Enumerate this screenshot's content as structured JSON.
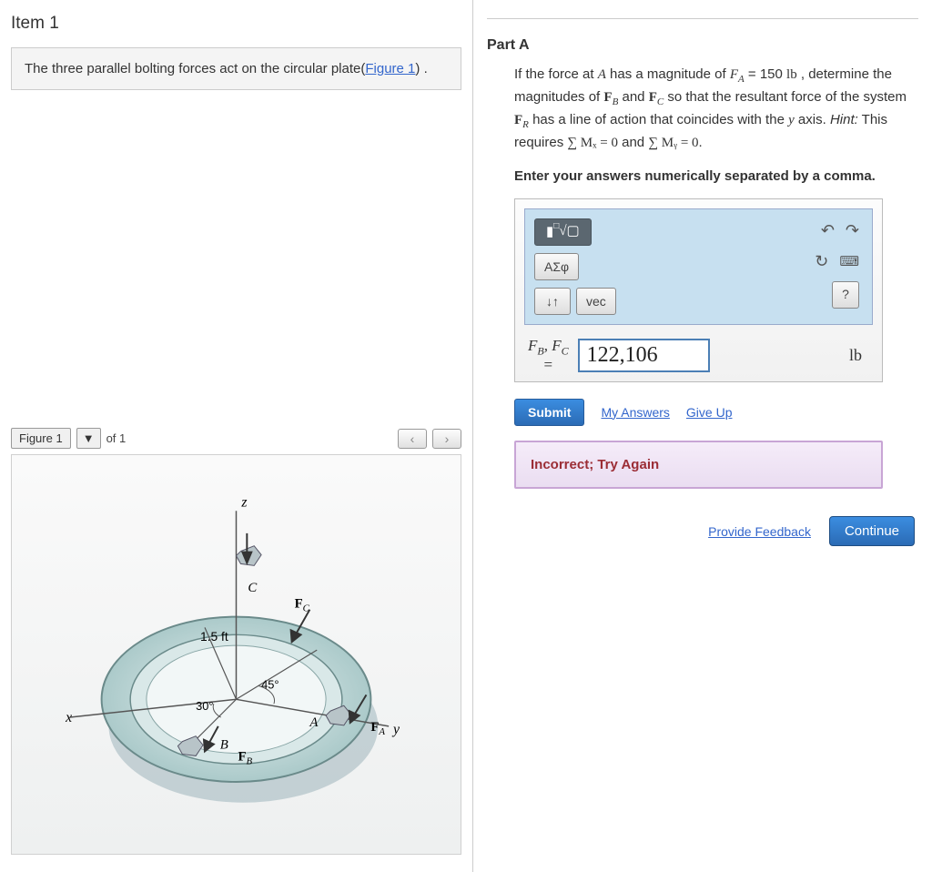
{
  "item": {
    "title": "Item 1",
    "problem_text_pre": "The three parallel bolting forces act on the circular plate(",
    "figure_link_text": "Figure 1",
    "problem_text_post": ") ."
  },
  "figure": {
    "label": "Figure 1",
    "count_text": "of 1",
    "annotations": {
      "z": "z",
      "x": "x",
      "y": "y",
      "C": "C",
      "B": "B",
      "A": "A",
      "Fc": "F",
      "Fc_sub": "C",
      "Fb": "F",
      "Fb_sub": "B",
      "Fa": "F",
      "Fa_sub": "A",
      "radius": "1.5 ft",
      "ang30": "30°",
      "ang45": "45°"
    }
  },
  "partA": {
    "heading": "Part A",
    "q_pre": "If the force at ",
    "q_A": "A",
    "q_mid1": " has a magnitude of ",
    "q_FA": "F",
    "q_FA_sub": "A",
    "q_val": " = 150 ",
    "q_unit": "lb",
    "q_mid2": " , determine the magnitudes of ",
    "q_FB": "F",
    "q_FB_sub": "B",
    "q_and": " and ",
    "q_FC": "F",
    "q_FC_sub": "C",
    "q_mid3": " so that the resultant force of the system ",
    "q_FR": "F",
    "q_FR_sub": "R",
    "q_mid4": " has a line of action that coincides with the ",
    "q_yaxis": "y",
    "q_mid5": " axis. ",
    "q_hint_label": "Hint:",
    "q_hint_text": " This requires ",
    "q_sumMx": "∑ Mₓ = 0",
    "q_and2": " and ",
    "q_sumMy": "∑ Mᵧ = 0",
    "q_period": ".",
    "instruction": "Enter your answers numerically separated by a comma.",
    "toolbar": {
      "templates": "√▢",
      "greek": "ΑΣφ",
      "vec": "vec",
      "help": "?"
    },
    "answer": {
      "label_line1_a": "F",
      "label_line1_a_sub": "B",
      "label_line1_sep": ", ",
      "label_line1_b": "F",
      "label_line1_b_sub": "C",
      "label_eq": "=",
      "value": "122,106",
      "unit": "lb"
    },
    "submit": "Submit",
    "my_answers": "My Answers",
    "give_up": "Give Up",
    "feedback": "Incorrect; Try Again",
    "provide_feedback": "Provide Feedback",
    "continue": "Continue"
  }
}
